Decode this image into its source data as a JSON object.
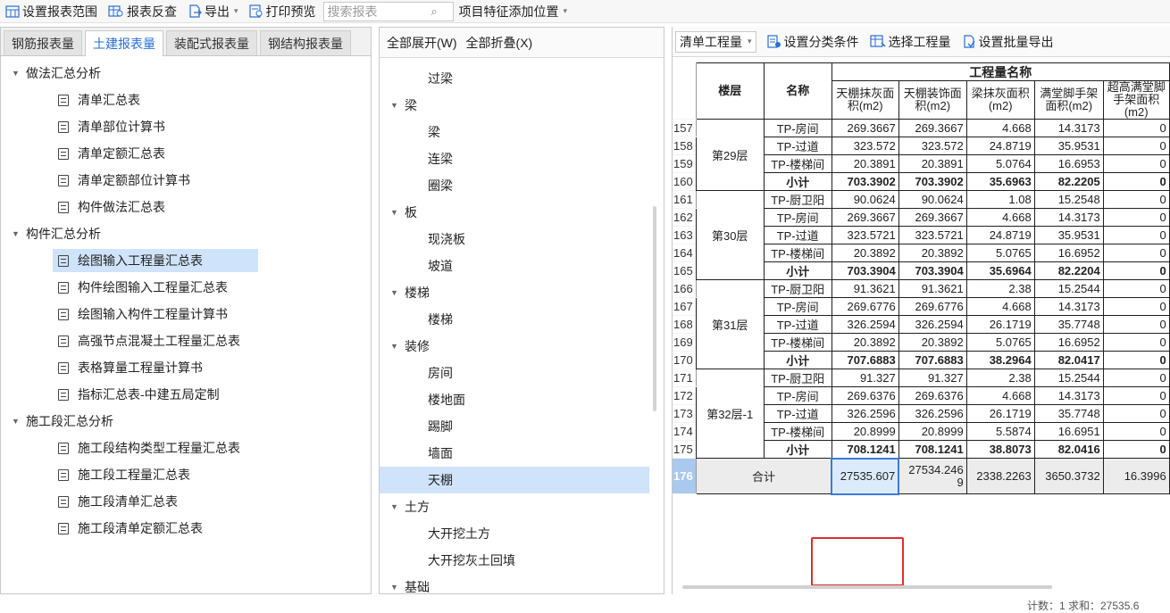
{
  "toolbar": {
    "set_range": "设置报表范围",
    "report_check": "报表反查",
    "export": "导出",
    "print_preview": "打印预览",
    "search_placeholder": "搜索报表",
    "add_feature": "项目特征添加位置"
  },
  "left": {
    "tabs": [
      "钢筋报表量",
      "土建报表量",
      "装配式报表量",
      "钢结构报表量"
    ],
    "active_tab": 1,
    "groups": [
      {
        "label": "做法汇总分析",
        "items": [
          "清单汇总表",
          "清单部位计算书",
          "清单定额汇总表",
          "清单定额部位计算书",
          "构件做法汇总表"
        ]
      },
      {
        "label": "构件汇总分析",
        "items": [
          "绘图输入工程量汇总表",
          "构件绘图输入工程量汇总表",
          "绘图输入构件工程量计算书",
          "高强节点混凝土工程量汇总表",
          "表格算量工程量计算书",
          "指标汇总表-中建五局定制"
        ]
      },
      {
        "label": "施工段汇总分析",
        "items": [
          "施工段结构类型工程量汇总表",
          "施工段工程量汇总表",
          "施工段清单汇总表",
          "施工段清单定额汇总表"
        ]
      }
    ],
    "selected_item": "绘图输入工程量汇总表"
  },
  "middle": {
    "expand_all": "全部展开(W)",
    "collapse_all": "全部折叠(X)",
    "rows": [
      {
        "type": "leaf",
        "label": "过梁"
      },
      {
        "type": "group",
        "label": "梁"
      },
      {
        "type": "leaf",
        "label": "梁"
      },
      {
        "type": "leaf",
        "label": "连梁"
      },
      {
        "type": "leaf",
        "label": "圈梁"
      },
      {
        "type": "group",
        "label": "板"
      },
      {
        "type": "leaf",
        "label": "现浇板"
      },
      {
        "type": "leaf",
        "label": "坡道"
      },
      {
        "type": "group",
        "label": "楼梯"
      },
      {
        "type": "leaf",
        "label": "楼梯"
      },
      {
        "type": "group",
        "label": "装修"
      },
      {
        "type": "leaf",
        "label": "房间"
      },
      {
        "type": "leaf",
        "label": "楼地面"
      },
      {
        "type": "leaf",
        "label": "踢脚"
      },
      {
        "type": "leaf",
        "label": "墙面"
      },
      {
        "type": "leaf",
        "label": "天棚",
        "selected": true
      },
      {
        "type": "group",
        "label": "土方"
      },
      {
        "type": "leaf",
        "label": "大开挖土方"
      },
      {
        "type": "leaf",
        "label": "大开挖灰土回填"
      },
      {
        "type": "group",
        "label": "基础"
      }
    ]
  },
  "right": {
    "dropdown_value": "清单工程量",
    "set_category": "设置分类条件",
    "select_quantity": "选择工程量",
    "batch_export": "设置批量导出",
    "header": {
      "floor": "楼层",
      "name": "名称",
      "group_title": "工程量名称",
      "cols": [
        "天棚抹灰面积(m2)",
        "天棚装饰面积(m2)",
        "梁抹灰面积(m2)",
        "满堂脚手架面积(m2)",
        "超高满堂脚手架面积(m2)"
      ]
    },
    "rows": [
      {
        "rn": "157",
        "floor": "第29层",
        "span": 4,
        "name": "TP-房间",
        "v": [
          "269.3667",
          "269.3667",
          "4.668",
          "14.3173",
          "0"
        ]
      },
      {
        "rn": "158",
        "name": "TP-过道",
        "v": [
          "323.572",
          "323.572",
          "24.8719",
          "35.9531",
          "0"
        ]
      },
      {
        "rn": "159",
        "name": "TP-楼梯间",
        "v": [
          "20.3891",
          "20.3891",
          "5.0764",
          "16.6953",
          "0"
        ]
      },
      {
        "rn": "160",
        "name": "小计",
        "sub": true,
        "v": [
          "703.3902",
          "703.3902",
          "35.6963",
          "82.2205",
          "0"
        ]
      },
      {
        "rn": "161",
        "floor": "第30层",
        "span": 5,
        "name": "TP-厨卫阳",
        "v": [
          "90.0624",
          "90.0624",
          "1.08",
          "15.2548",
          "0"
        ]
      },
      {
        "rn": "162",
        "name": "TP-房间",
        "v": [
          "269.3667",
          "269.3667",
          "4.668",
          "14.3173",
          "0"
        ]
      },
      {
        "rn": "163",
        "name": "TP-过道",
        "v": [
          "323.5721",
          "323.5721",
          "24.8719",
          "35.9531",
          "0"
        ]
      },
      {
        "rn": "164",
        "name": "TP-楼梯间",
        "v": [
          "20.3892",
          "20.3892",
          "5.0765",
          "16.6952",
          "0"
        ]
      },
      {
        "rn": "165",
        "name": "小计",
        "sub": true,
        "v": [
          "703.3904",
          "703.3904",
          "35.6964",
          "82.2204",
          "0"
        ]
      },
      {
        "rn": "166",
        "floor": "第31层",
        "span": 5,
        "name": "TP-厨卫阳",
        "v": [
          "91.3621",
          "91.3621",
          "2.38",
          "15.2544",
          "0"
        ]
      },
      {
        "rn": "167",
        "name": "TP-房间",
        "v": [
          "269.6776",
          "269.6776",
          "4.668",
          "14.3173",
          "0"
        ]
      },
      {
        "rn": "168",
        "name": "TP-过道",
        "v": [
          "326.2594",
          "326.2594",
          "26.1719",
          "35.7748",
          "0"
        ]
      },
      {
        "rn": "169",
        "name": "TP-楼梯间",
        "v": [
          "20.3892",
          "20.3892",
          "5.0765",
          "16.6952",
          "0"
        ]
      },
      {
        "rn": "170",
        "name": "小计",
        "sub": true,
        "v": [
          "707.6883",
          "707.6883",
          "38.2964",
          "82.0417",
          "0"
        ]
      },
      {
        "rn": "171",
        "floor": "第32层-1",
        "span": 5,
        "name": "TP-厨卫阳",
        "v": [
          "91.327",
          "91.327",
          "2.38",
          "15.2544",
          "0"
        ]
      },
      {
        "rn": "172",
        "name": "TP-房间",
        "v": [
          "269.6376",
          "269.6376",
          "4.668",
          "14.3173",
          "0"
        ]
      },
      {
        "rn": "173",
        "name": "TP-过道",
        "v": [
          "326.2596",
          "326.2596",
          "26.1719",
          "35.7748",
          "0"
        ]
      },
      {
        "rn": "174",
        "name": "TP-楼梯间",
        "v": [
          "20.8999",
          "20.8999",
          "5.5874",
          "16.6951",
          "0"
        ]
      },
      {
        "rn": "175",
        "name": "小计",
        "sub": true,
        "v": [
          "708.1241",
          "708.1241",
          "38.8073",
          "82.0416",
          "0"
        ]
      }
    ],
    "total": {
      "rn": "176",
      "label": "合计",
      "v": [
        "27535.607",
        "27534.2469",
        "2338.2263",
        "3650.3732",
        "16.3996"
      ]
    }
  },
  "status": "计数：1 求和：27535.6",
  "colors": {
    "accent": "#2a6fd6",
    "selection": "#cfe3fa",
    "highlight": "#e22b2b"
  }
}
